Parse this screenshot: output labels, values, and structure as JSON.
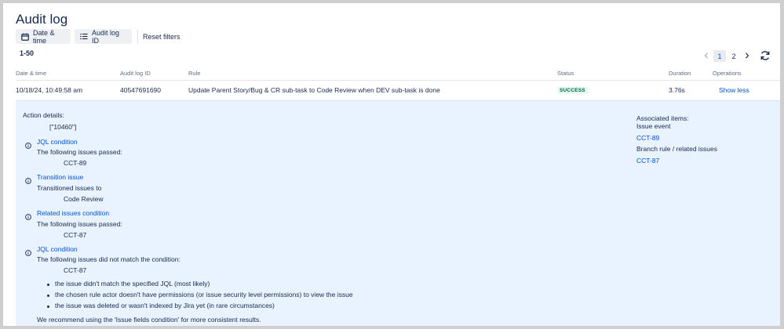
{
  "page": {
    "title": "Audit log"
  },
  "filters": {
    "date_time": "Date & time",
    "audit_log_id": "Audit log ID",
    "reset": "Reset filters"
  },
  "results": {
    "range": "1-50"
  },
  "pagination": {
    "pages": [
      "1",
      "2"
    ],
    "current": "1"
  },
  "table": {
    "headers": {
      "date_time": "Date & time",
      "audit_log_id": "Audit log ID",
      "rule": "Rule",
      "status": "Status",
      "duration": "Duration",
      "operations": "Operations"
    },
    "row": {
      "date_time": "10/18/24, 10:49:58 am",
      "audit_log_id": "40547691690",
      "rule": "Update Parent Story/Bug & CR sub-task to Code Review when DEV sub-task is done",
      "status": "SUCCESS",
      "duration": "3.76s",
      "operation": "Show less"
    }
  },
  "details": {
    "action_label": "Action details:",
    "action_value": "[\"10460\"]",
    "sections": [
      {
        "title": "JQL condition",
        "text": "The following issues passed:",
        "item": "CCT-89"
      },
      {
        "title": "Transition issue",
        "text": "Transitioned issues to",
        "item": "Code Review"
      },
      {
        "title": "Related issues condition",
        "text": "The following issues passed:",
        "item": "CCT-87"
      },
      {
        "title": "JQL condition",
        "text": "The following issues did not match the condition:",
        "item": "CCT-87"
      }
    ],
    "bullets": [
      "the issue didn't match the specified JQL (most likely)",
      "the chosen rule actor doesn't have permissions (or issue security level permissions) to view the issue",
      "the issue was deleted or wasn't indexed by Jira yet (in rare circumstances)"
    ],
    "recommendation": "We recommend using the 'Issue fields condition' for more consistent results.",
    "associated": {
      "label": "Associated items:",
      "issue_event": "Issue event",
      "issue_event_item": "CCT-89",
      "branch_rule": "Branch rule / related issues",
      "branch_rule_item": "CCT-87"
    }
  },
  "colors": {
    "link": "#0052cc",
    "text": "#172b4d",
    "success_bg": "#e3fcef",
    "success_text": "#006644",
    "details_bg": "#e9f2ff"
  }
}
